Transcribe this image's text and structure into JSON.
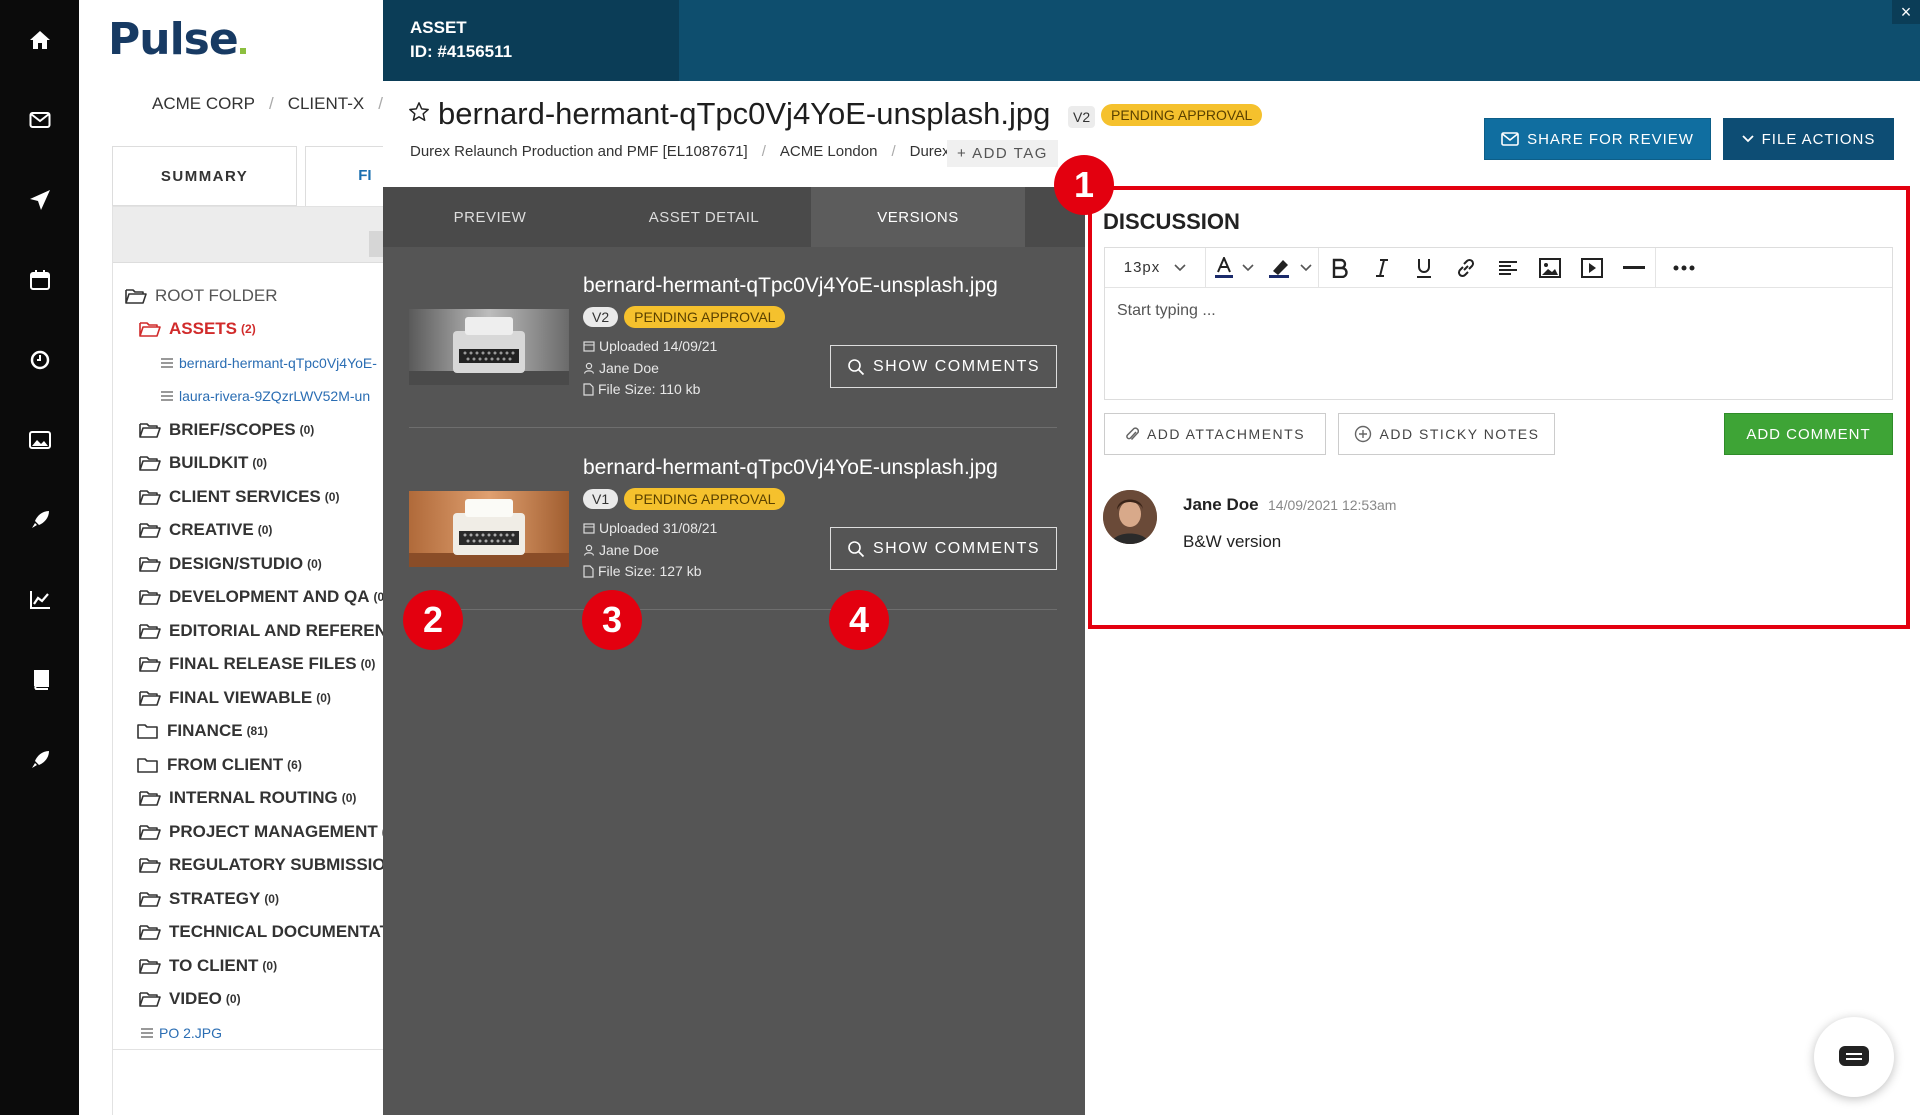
{
  "app": {
    "logo": "Pulse"
  },
  "rail": {
    "icons": [
      "home-icon",
      "mail-icon",
      "send-icon",
      "calendar-icon",
      "clock-icon",
      "image-icon",
      "rocket-icon",
      "chart-icon",
      "book-icon",
      "rocket2-icon"
    ]
  },
  "background": {
    "breadcrumb": [
      "ACME CORP",
      "CLIENT-X"
    ],
    "tabs": {
      "summary": "SUMMARY",
      "files": "FI"
    },
    "tree": [
      {
        "label": "ROOT FOLDER",
        "count": "",
        "type": "root"
      },
      {
        "label": "ASSETS",
        "count": "(2)",
        "type": "assets"
      },
      {
        "label": "bernard-hermant-qTpc0Vj4YoE-",
        "count": "",
        "type": "file"
      },
      {
        "label": "laura-rivera-9ZQzrLWV52M-un",
        "count": "",
        "type": "file"
      },
      {
        "label": "BRIEF/SCOPES",
        "count": "(0)",
        "type": "folder"
      },
      {
        "label": "BUILDKIT",
        "count": "(0)",
        "type": "folder"
      },
      {
        "label": "CLIENT SERVICES",
        "count": "(0)",
        "type": "folder"
      },
      {
        "label": "CREATIVE",
        "count": "(0)",
        "type": "folder"
      },
      {
        "label": "DESIGN/STUDIO",
        "count": "(0)",
        "type": "folder"
      },
      {
        "label": "DEVELOPMENT AND QA",
        "count": "(0",
        "type": "folder"
      },
      {
        "label": "EDITORIAL AND REFERENC",
        "count": "",
        "type": "folder"
      },
      {
        "label": "FINAL RELEASE FILES",
        "count": "(0)",
        "type": "folder"
      },
      {
        "label": "FINAL VIEWABLE",
        "count": "(0)",
        "type": "folder"
      },
      {
        "label": "FINANCE",
        "count": "(81)",
        "type": "folder-empty"
      },
      {
        "label": "FROM CLIENT",
        "count": "(6)",
        "type": "folder-empty"
      },
      {
        "label": "INTERNAL ROUTING",
        "count": "(0)",
        "type": "folder"
      },
      {
        "label": "PROJECT MANAGEMENT",
        "count": "(",
        "type": "folder"
      },
      {
        "label": "REGULATORY SUBMISSION",
        "count": "",
        "type": "folder"
      },
      {
        "label": "STRATEGY",
        "count": "(0)",
        "type": "folder"
      },
      {
        "label": "TECHNICAL DOCUMENTAT",
        "count": "",
        "type": "folder"
      },
      {
        "label": "TO CLIENT",
        "count": "(0)",
        "type": "folder"
      },
      {
        "label": "VIDEO",
        "count": "(0)",
        "type": "folder"
      },
      {
        "label": "PO 2.JPG",
        "count": "",
        "type": "file"
      }
    ]
  },
  "asset": {
    "label": "ASSET",
    "id": "ID: #4156511",
    "close": "×",
    "title": "bernard-hermant-qTpc0Vj4YoE-unsplash.jpg",
    "version": "V2",
    "status": "PENDING APPROVAL",
    "crumbs": [
      "Durex Relaunch Production and PMF [EL1087671]",
      "ACME London",
      "Durex"
    ],
    "add_tag": "+ ADD TAG",
    "share_button": "SHARE FOR REVIEW",
    "actions_button": "FILE ACTIONS"
  },
  "tabs": {
    "preview": "PREVIEW",
    "detail": "ASSET DETAIL",
    "versions": "VERSIONS"
  },
  "versions": [
    {
      "name": "bernard-hermant-qTpc0Vj4YoE-unsplash.jpg",
      "version": "V2",
      "status": "PENDING APPROVAL",
      "uploaded": "Uploaded 14/09/21",
      "user": "Jane Doe",
      "size": "File Size: 110 kb",
      "button": "SHOW COMMENTS"
    },
    {
      "name": "bernard-hermant-qTpc0Vj4YoE-unsplash.jpg",
      "version": "V1",
      "status": "PENDING APPROVAL",
      "uploaded": "Uploaded 31/08/21",
      "user": "Jane Doe",
      "size": "File Size: 127 kb",
      "button": "SHOW COMMENTS"
    }
  ],
  "callouts": [
    "1",
    "2",
    "3",
    "4"
  ],
  "discussion": {
    "title": "DISCUSSION",
    "font_size": "13px",
    "placeholder": "Start typing ...",
    "attach_button": "ADD ATTACHMENTS",
    "sticky_button": "ADD STICKY NOTES",
    "comment_button": "ADD COMMENT",
    "comments": [
      {
        "author": "Jane Doe",
        "date": "14/09/2021 12:53am",
        "text": "B&W version"
      }
    ]
  },
  "colors": {
    "accent": "#106ea0",
    "status": "#f5c12d",
    "callout": "#e3000f",
    "green": "#3ea436"
  }
}
